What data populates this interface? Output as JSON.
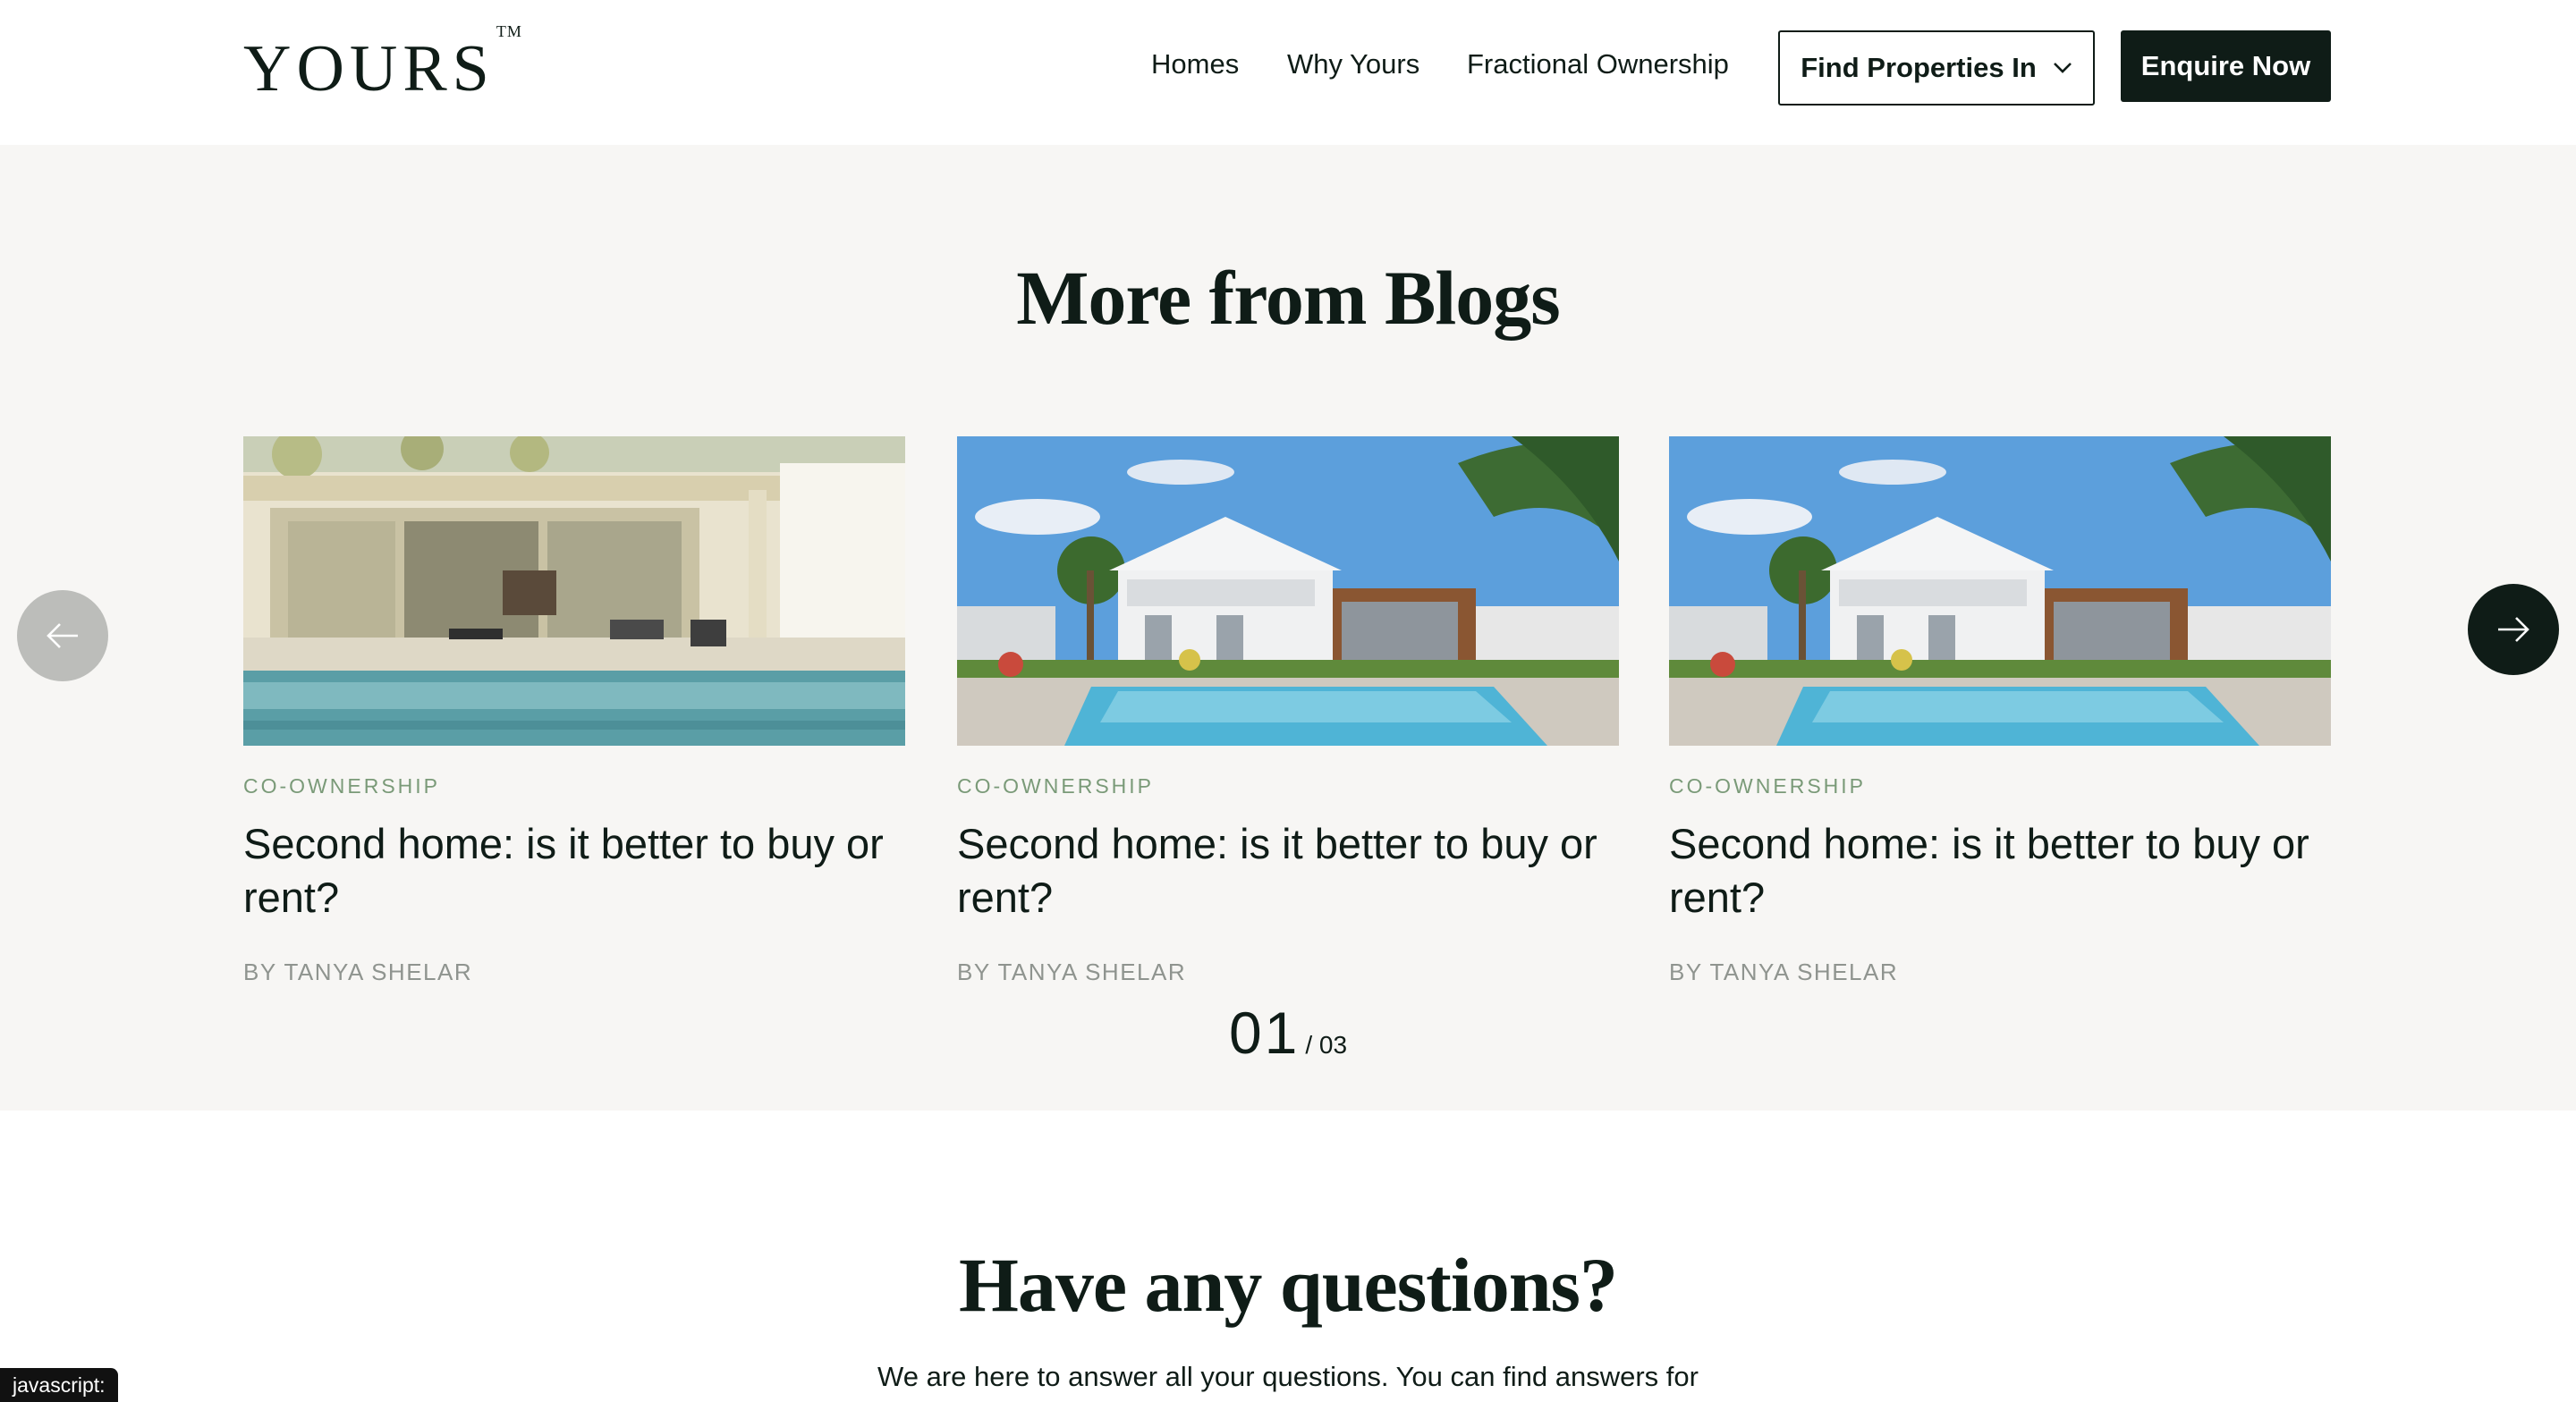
{
  "header": {
    "logo": "YOURS",
    "logo_mark": "TM",
    "nav": [
      "Homes",
      "Why Yours",
      "Fractional Ownership"
    ],
    "find_properties": "Find Properties In",
    "enquire": "Enquire Now"
  },
  "blogs": {
    "title": "More from Blogs",
    "cards": [
      {
        "category": "CO-OWNERSHIP",
        "title": "Second home: is it better to buy or rent?",
        "author": "BY TANYA SHELAR",
        "image": "modern-pool-house"
      },
      {
        "category": "CO-OWNERSHIP",
        "title": "Second home: is it better to buy or rent?",
        "author": "BY TANYA SHELAR",
        "image": "white-villa-pool"
      },
      {
        "category": "CO-OWNERSHIP",
        "title": "Second home: is it better to buy or rent?",
        "author": "BY TANYA SHELAR",
        "image": "white-villa-pool"
      }
    ],
    "pager": {
      "current": "01",
      "total": "/ 03"
    }
  },
  "questions": {
    "title": "Have any questions?",
    "subtitle": "We are here to answer all your questions. You can find answers for"
  },
  "status_bar": "javascript:",
  "colors": {
    "brand_dark": "#0f1c17",
    "section_bg": "#f7f6f4",
    "category_green": "#7a9a78"
  }
}
